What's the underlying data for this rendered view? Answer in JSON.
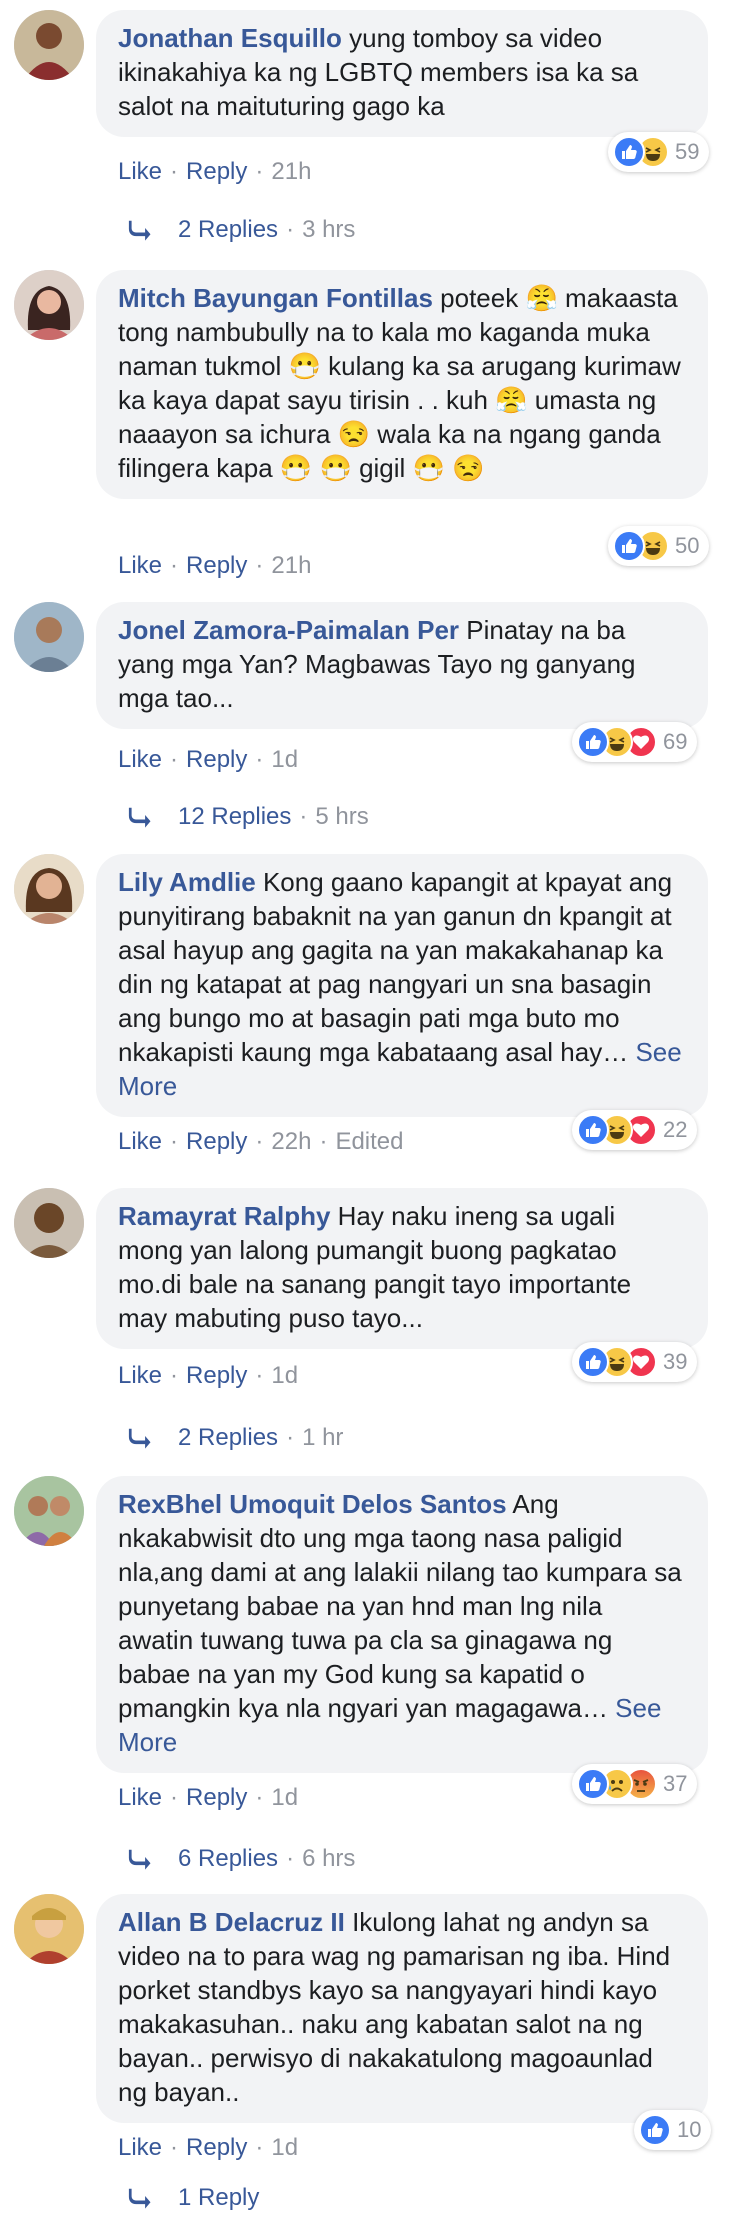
{
  "actions": {
    "like": "Like",
    "reply": "Reply",
    "separator": "·",
    "see_more": "See More",
    "edited": "Edited"
  },
  "comments": [
    {
      "author": "Jonathan Esquillo",
      "text": "yung tomboy sa video ikinakahiya ka ng LGBTQ members isa ka sa salot na maituturing gago ka",
      "time": "21h",
      "reactions": [
        "like",
        "haha"
      ],
      "reaction_count": "59",
      "replies": "2 Replies",
      "replies_time": "3 hrs",
      "avatar_color": "#8a2e2e"
    },
    {
      "author": "Mitch Bayungan Fontillas",
      "text": "poteek 😤 makaasta tong nambubully na to kala mo kaganda muka naman tukmol 😷 kulang ka sa arugang kurimaw ka kaya dapat sayu tirisin . . kuh 😤 umasta ng naaayon sa ichura 😒 wala ka na ngang ganda filingera kapa 😷 😷 gigil 😷 😒",
      "time": "21h",
      "reactions": [
        "like",
        "haha"
      ],
      "reaction_count": "50",
      "avatar_color": "#c96a6a"
    },
    {
      "author": "Jonel Zamora-Paimalan Per",
      "text": "Pinatay na ba yang mga Yan? Magbawas Tayo ng ganyang mga tao...",
      "time": "1d",
      "reactions": [
        "like",
        "haha",
        "love"
      ],
      "reaction_count": "69",
      "replies": "12 Replies",
      "replies_time": "5 hrs",
      "avatar_color": "#6b7f94"
    },
    {
      "author": "Lily Amdlie",
      "text": "Kong gaano kapangit at kpayat ang punyitirang babaknit na yan ganun dn kpangit at asal hayup ang gagita na yan makakahanap ka din ng katapat at pag nangyari un sna basagin ang bungo mo at basagin pati mga buto mo nkakapisti kaung mga kabataang asal hay…",
      "see_more": true,
      "time": "22h",
      "edited": true,
      "reactions": [
        "like",
        "haha",
        "love"
      ],
      "reaction_count": "22",
      "avatar_color": "#b9856b"
    },
    {
      "author": "Ramayrat Ralphy",
      "text": "Hay naku ineng sa ugali mong yan lalong pumangit buong pagkatao mo.di bale na sanang pangit tayo importante may mabuting puso tayo...",
      "time": "1d",
      "reactions": [
        "like",
        "haha",
        "love"
      ],
      "reaction_count": "39",
      "replies": "2 Replies",
      "replies_time": "1 hr",
      "avatar_color": "#7a5a3c"
    },
    {
      "author": "RexBhel Umoquit Delos Santos",
      "text": "Ang nkakabwisit dto ung mga taong nasa paligid nla,ang dami at ang lalakii nilang tao kumpara sa punyetang babae na yan hnd man lng nila awatin tuwang tuwa pa cla sa ginagawa ng babae na yan my God kung sa kapatid o pmangkin kya nla ngyari yan magagawa…",
      "see_more": true,
      "time": "1d",
      "reactions": [
        "like",
        "sad",
        "angry"
      ],
      "reaction_count": "37",
      "replies": "6 Replies",
      "replies_time": "6 hrs",
      "avatar_color": "#8e6aa8"
    },
    {
      "author": "Allan B Delacruz II",
      "text": "Ikulong lahat ng andyn sa video na to para wag ng pamarisan ng iba. Hind porket standbys kayo sa nangyayari hindi kayo makakasuhan.. naku ang kabatan salot na ng bayan.. perwisyo di nakakatulong magoaunlad ng bayan..",
      "time": "1d",
      "reactions": [
        "like"
      ],
      "reaction_count": "10",
      "replies": "1 Reply",
      "avatar_color": "#b0402e"
    }
  ]
}
